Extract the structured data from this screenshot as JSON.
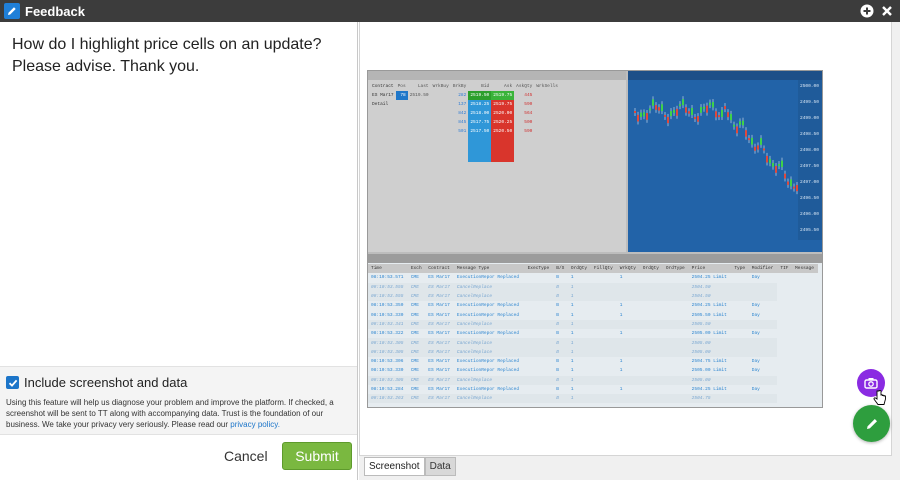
{
  "window": {
    "title": "Feedback"
  },
  "feedback": {
    "message": "How do I highlight price cells on an update? Please advise. Thank you.",
    "include_label": "Include screenshot and data",
    "include_checked": true,
    "disclaimer": "Using this feature will help us diagnose your problem and improve the platform. If checked, a screenshot will be sent to TT along with accompanying data. Trust is the foundation of our business. We take your privacy very seriously. Please read our",
    "privacy_link": "privacy policy.",
    "cancel_label": "Cancel",
    "submit_label": "Submit"
  },
  "preview": {
    "tabs": [
      {
        "label": "Screenshot",
        "active": true
      },
      {
        "label": "Data",
        "active": false
      }
    ]
  },
  "screenshot": {
    "book_headers": [
      "Contract",
      "Pos",
      "Last",
      "WrkBuy",
      "BrkBy",
      "Bid",
      "Ask",
      "AskQty",
      "WrkSells"
    ],
    "book_row": [
      "ES Mar17",
      "78",
      "2519.50",
      "",
      "",
      "2519.50",
      "2519.75",
      "",
      ""
    ],
    "book_sub": "Detail",
    "bid_prices": [
      "2519.50",
      "2518.25",
      "2518.00",
      "2517.75",
      "2517.50"
    ],
    "ask_prices": [
      "2519.75",
      "2519.75",
      "2520.00",
      "2520.25",
      "2520.50"
    ],
    "bid_qty": [
      "282",
      "137",
      "842",
      "845",
      "501"
    ],
    "ask_qty": [
      "445",
      "590",
      "564",
      "500",
      "590"
    ],
    "chart_prices": [
      "2500.00",
      "2499.50",
      "2499.00",
      "2498.50",
      "2498.00",
      "2497.50",
      "2497.00",
      "2496.50",
      "2496.00",
      "2495.50"
    ],
    "grid_headers": [
      "Time",
      "Exch",
      "Contract",
      "Message Type",
      "ExecType",
      "B/S",
      "OrdQty",
      "FillQty",
      "WrkQty",
      "OrdQty",
      "OrdType",
      "Price",
      "Type",
      "Modifier",
      "TIF",
      "Message"
    ],
    "grid_rows": [
      [
        "08:10:53.571",
        "CME",
        "ES Mar17",
        "ExecutionRepor Replaced",
        "",
        "B",
        "1",
        "",
        "1",
        "",
        "",
        "2504.25 Limit",
        "",
        "Day"
      ],
      [
        "08:10:53.555",
        "CME",
        "ES Mar17",
        "CancelReplace",
        "",
        "B",
        "1",
        "",
        "",
        "",
        "",
        "2504.50",
        "",
        ""
      ],
      [
        "08:10:53.555",
        "CME",
        "ES Mar17",
        "CancelReplace",
        "",
        "B",
        "1",
        "",
        "",
        "",
        "",
        "2504.50",
        "",
        ""
      ],
      [
        "08:10:53.350",
        "CME",
        "ES Mar17",
        "ExecutionRepor Replaced",
        "",
        "B",
        "1",
        "",
        "1",
        "",
        "",
        "2504.25 Limit",
        "",
        "Day"
      ],
      [
        "08:10:53.330",
        "CME",
        "ES Mar17",
        "ExecutionRepor Replaced",
        "",
        "B",
        "1",
        "",
        "1",
        "",
        "",
        "2505.50 Limit",
        "",
        "Day"
      ],
      [
        "08:10:53.341",
        "CME",
        "ES Mar17",
        "CancelReplace",
        "",
        "B",
        "1",
        "",
        "",
        "",
        "",
        "2505.50",
        "",
        ""
      ],
      [
        "08:10:53.322",
        "CME",
        "ES Mar17",
        "ExecutionRepor Replaced",
        "",
        "B",
        "1",
        "",
        "1",
        "",
        "",
        "2505.00 Limit",
        "",
        "Day"
      ],
      [
        "08:10:53.305",
        "CME",
        "ES Mar17",
        "CancelReplace",
        "",
        "B",
        "1",
        "",
        "",
        "",
        "",
        "2505.00",
        "",
        ""
      ],
      [
        "08:10:53.305",
        "CME",
        "ES Mar17",
        "CancelReplace",
        "",
        "B",
        "1",
        "",
        "",
        "",
        "",
        "2505.00",
        "",
        ""
      ],
      [
        "08:10:53.306",
        "CME",
        "ES Mar17",
        "ExecutionRepor Replaced",
        "",
        "B",
        "1",
        "",
        "1",
        "",
        "",
        "2504.75 Limit",
        "",
        "Day"
      ],
      [
        "08:10:53.330",
        "CME",
        "ES Mar17",
        "ExecutionRepor Replaced",
        "",
        "B",
        "1",
        "",
        "1",
        "",
        "",
        "2505.00 Limit",
        "",
        "Day"
      ],
      [
        "08:10:53.305",
        "CME",
        "ES Mar17",
        "CancelReplace",
        "",
        "B",
        "1",
        "",
        "",
        "",
        "",
        "2505.00",
        "",
        ""
      ],
      [
        "08:10:53.284",
        "CME",
        "ES Mar17",
        "ExecutionRepor Replaced",
        "",
        "B",
        "1",
        "",
        "1",
        "",
        "",
        "2504.25 Limit",
        "",
        "Day"
      ],
      [
        "08:10:53.263",
        "CME",
        "ES Mar17",
        "CancelReplace",
        "",
        "B",
        "1",
        "",
        "",
        "",
        "",
        "2504.75",
        "",
        ""
      ]
    ]
  },
  "colors": {
    "accent": "#1c75c9",
    "submit": "#7ab840",
    "camera": "#8a2be2",
    "pen": "#2e9e3e"
  }
}
